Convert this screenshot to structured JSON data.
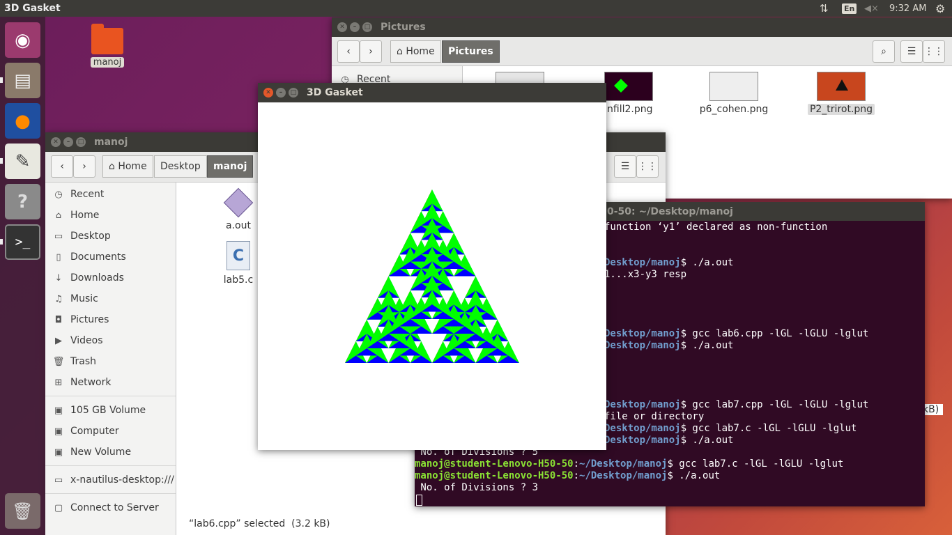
{
  "topbar": {
    "app_title": "3D Gasket",
    "lang": "En",
    "time": "9:32 AM"
  },
  "launcher": [
    {
      "name": "ubuntu-dash-icon",
      "glyph": "◉"
    },
    {
      "name": "files-icon",
      "glyph": "▤"
    },
    {
      "name": "firefox-icon",
      "glyph": "●"
    },
    {
      "name": "text-editor-icon",
      "glyph": "✎"
    },
    {
      "name": "help-icon",
      "glyph": "?"
    },
    {
      "name": "terminal-icon",
      "glyph": ">_"
    },
    {
      "name": "trash-icon",
      "glyph": "🗑"
    }
  ],
  "desktop": {
    "folder_label": "manoj"
  },
  "pictures": {
    "title": "Pictures",
    "crumbs": [
      "Home",
      "Pictures"
    ],
    "recent": "Recent",
    "files": [
      "scanfill2.png",
      "p6_cohen.png",
      "P2_trirot.png"
    ]
  },
  "manoj": {
    "title": "manoj",
    "crumbs": [
      "Home",
      "Desktop",
      "manoj"
    ],
    "sidebar": [
      "Recent",
      "Home",
      "Desktop",
      "Documents",
      "Downloads",
      "Music",
      "Pictures",
      "Videos",
      "Trash",
      "Network",
      "105 GB Volume",
      "Computer",
      "New Volume",
      "x-nautilus-desktop:///",
      "Connect to Server"
    ],
    "files": [
      "a.out",
      "lab5.c"
    ],
    "status": "“lab6.cpp” selected  (3.2 kB)"
  },
  "status_right": "kB)",
  "terminal": {
    "title": "0-50: ~/Desktop/manoj",
    "lines": [
      {
        "pre": "",
        "user": "",
        "path": "",
        "rest": "function ‘y1’ declared as non-function"
      },
      {
        "pre": "",
        "user": "",
        "path": "",
        "rest": ""
      },
      {
        "pre": "",
        "user": "",
        "path": "",
        "rest": ""
      },
      {
        "pre": "",
        "user": "",
        "path": "Desktop/manoj",
        "rest": "$ ./a.out"
      },
      {
        "pre": "",
        "user": "",
        "path": "",
        "rest": "1...x3-y3 resp"
      },
      {
        "pre": "",
        "user": "",
        "path": "",
        "rest": ""
      },
      {
        "pre": "",
        "user": "",
        "path": "",
        "rest": ""
      },
      {
        "pre": "",
        "user": "",
        "path": "",
        "rest": ""
      },
      {
        "pre": "",
        "user": "",
        "path": "",
        "rest": ""
      },
      {
        "pre": "",
        "user": "",
        "path": "Desktop/manoj",
        "rest": "$ gcc lab6.cpp -lGL -lGLU -lglut"
      },
      {
        "pre": "",
        "user": "",
        "path": "Desktop/manoj",
        "rest": "$ ./a.out"
      },
      {
        "pre": "",
        "user": "",
        "path": "",
        "rest": ""
      },
      {
        "pre": "",
        "user": "",
        "path": "",
        "rest": ""
      },
      {
        "pre": "",
        "user": "",
        "path": "",
        "rest": ""
      },
      {
        "pre": "",
        "user": "",
        "path": "",
        "rest": ""
      },
      {
        "pre": "",
        "user": "",
        "path": "Desktop/manoj",
        "rest": "$ gcc lab7.cpp -lGL -lGLU -lglut"
      },
      {
        "pre": "",
        "user": "",
        "path": "",
        "rest": "file or directory"
      },
      {
        "pre": "",
        "user": "",
        "path": "Desktop/manoj",
        "rest": "$ gcc lab7.c -lGL -lGLU -lglut"
      },
      {
        "pre": "",
        "user": "",
        "path": "Desktop/manoj",
        "rest": "$ ./a.out"
      },
      {
        "pre": " No. of Divisions ? 5",
        "user": "",
        "path": "",
        "rest": ""
      },
      {
        "pre": "",
        "user": "manoj@student-Lenovo-H50-50",
        "path": "~/Desktop/manoj",
        "rest": "$ gcc lab7.c -lGL -lGLU -lglut"
      },
      {
        "pre": "",
        "user": "manoj@student-Lenovo-H50-50",
        "path": "~/Desktop/manoj",
        "rest": "$ ./a.out"
      },
      {
        "pre": " No. of Divisions ? 3",
        "user": "",
        "path": "",
        "rest": ""
      }
    ]
  },
  "gasket": {
    "title": "3D Gasket",
    "divisions": 3,
    "colors": {
      "red": "#ff0000",
      "green": "#00ff00",
      "blue": "#0000ff",
      "cyan": "#00ffff"
    }
  }
}
